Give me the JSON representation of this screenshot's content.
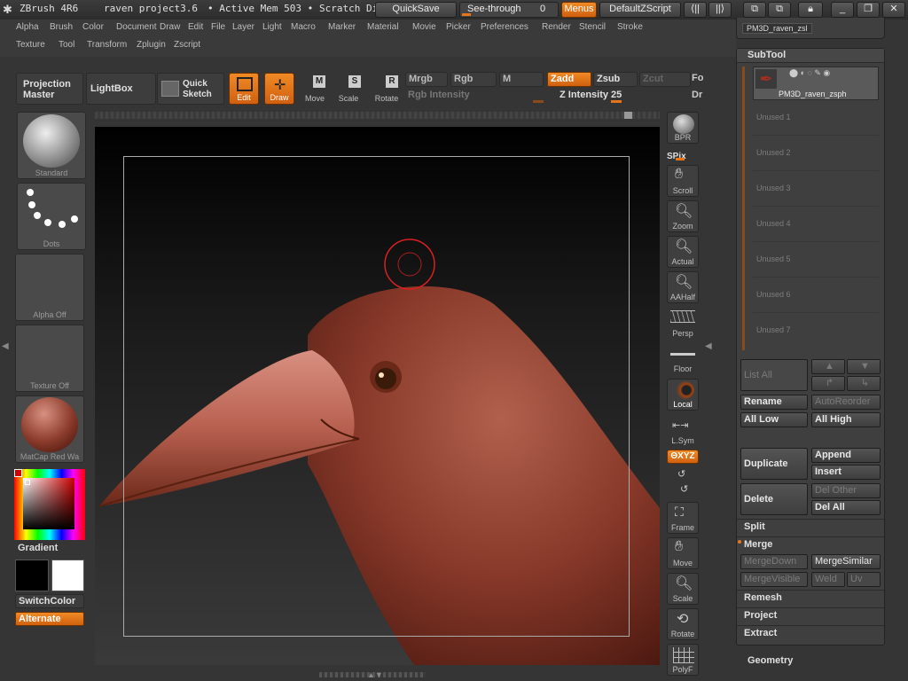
{
  "title_bar": {
    "app_name": "ZBrush 4R6",
    "project": "raven project3.6",
    "active_mem": "• Active Mem 503 •",
    "scratch": "Scratch Di",
    "quicksave": "QuickSave",
    "see_through_label": "See-through",
    "see_through_value": "0",
    "menus": "Menus",
    "default_zscript": "DefaultZScript"
  },
  "menu_row1": [
    "Alpha",
    "Brush",
    "Color",
    "Document",
    "Draw",
    "Edit",
    "File",
    "Layer",
    "Light",
    "Macro",
    "Marker",
    "Material",
    "Movie",
    "Picker",
    "Preferences",
    "Render",
    "Stencil",
    "Stroke"
  ],
  "menu_row2": [
    "Texture",
    "Tool",
    "Transform",
    "Zplugin",
    "Zscript"
  ],
  "toolbar": {
    "projection_master": "Projection Master",
    "lightbox": "LightBox",
    "quick_sketch": "Quick Sketch",
    "edit": "Edit",
    "draw": "Draw",
    "move": "Move",
    "scale": "Scale",
    "rotate": "Rotate",
    "mrgb": "Mrgb",
    "rgb": "Rgb",
    "m": "M",
    "rgb_intensity": "Rgb Intensity",
    "zadd": "Zadd",
    "zsub": "Zsub",
    "zcut": "Zcut",
    "z_intensity": "Z Intensity 25",
    "focal": "Fo",
    "draw_size": "Dr"
  },
  "left_shelf": {
    "brush": "Standard",
    "stroke": "Dots",
    "alpha": "Alpha Off",
    "texture": "Texture Off",
    "material": "MatCap Red Wa",
    "gradient": "Gradient",
    "switch_color": "SwitchColor",
    "alternate": "Alternate"
  },
  "right_shelf": {
    "bpr": "BPR",
    "spix": "SPix",
    "scroll": "Scroll",
    "zoom": "Zoom",
    "actual": "Actual",
    "aahalf": "AAHalf",
    "persp": "Persp",
    "floor": "Floor",
    "local": "Local",
    "lsym": "L.Sym",
    "xyz": "ΘXYZ",
    "frame": "Frame",
    "move": "Move",
    "scale": "Scale",
    "rotate": "Rotate",
    "polyf": "PolyF"
  },
  "subtool_panel": {
    "top_item": "PM3D_raven_zsl",
    "header": "SubTool",
    "active_subtool": "PM3D_raven_zsph",
    "unused_slots": [
      "Unused 1",
      "Unused 2",
      "Unused 3",
      "Unused 4",
      "Unused 5",
      "Unused 6",
      "Unused 7"
    ],
    "list_all": "List All",
    "rename": "Rename",
    "auto_reorder": "AutoReorder",
    "all_low": "All Low",
    "all_high": "All High",
    "duplicate": "Duplicate",
    "append": "Append",
    "insert": "Insert",
    "delete": "Delete",
    "del_other": "Del Other",
    "del_all": "Del All",
    "split": "Split",
    "merge": "Merge",
    "merge_down": "MergeDown",
    "merge_similar": "MergeSimilar",
    "merge_visible": "MergeVisible",
    "weld": "Weld",
    "uv": "Uv",
    "remesh": "Remesh",
    "project": "Project",
    "extract": "Extract",
    "geometry": "Geometry"
  },
  "colors": {
    "accent": "#e8741a",
    "bird_skin": "#8a3a2a",
    "background": "#353535"
  }
}
